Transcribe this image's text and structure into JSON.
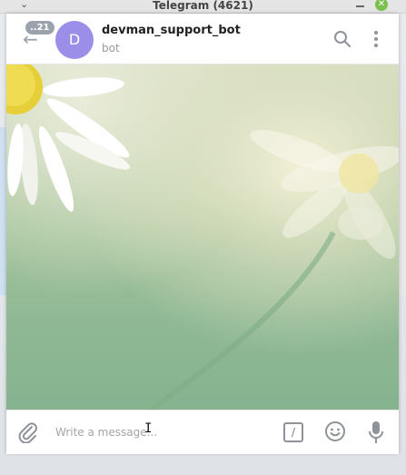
{
  "window": {
    "title": "Telegram (4621)",
    "menu_icon": "chevron-down-icon",
    "minimize_icon": "minimize-icon",
    "close_icon": "close-icon",
    "close_color": "#79c04e"
  },
  "header": {
    "back_icon": "back-arrow-icon",
    "unread_count": "..21",
    "avatar_letter": "D",
    "avatar_color": "#9a8ee8",
    "chat_name": "devman_support_bot",
    "chat_status": "bot",
    "search_icon": "search-icon",
    "more_icon": "more-vertical-icon"
  },
  "wallpaper": {
    "description_icon": "daisy-wallpaper"
  },
  "composer": {
    "attach_icon": "paperclip-icon",
    "placeholder": "Write a message...",
    "commands_label": "/",
    "emoji_icon": "emoji-icon",
    "mic_icon": "microphone-icon"
  }
}
